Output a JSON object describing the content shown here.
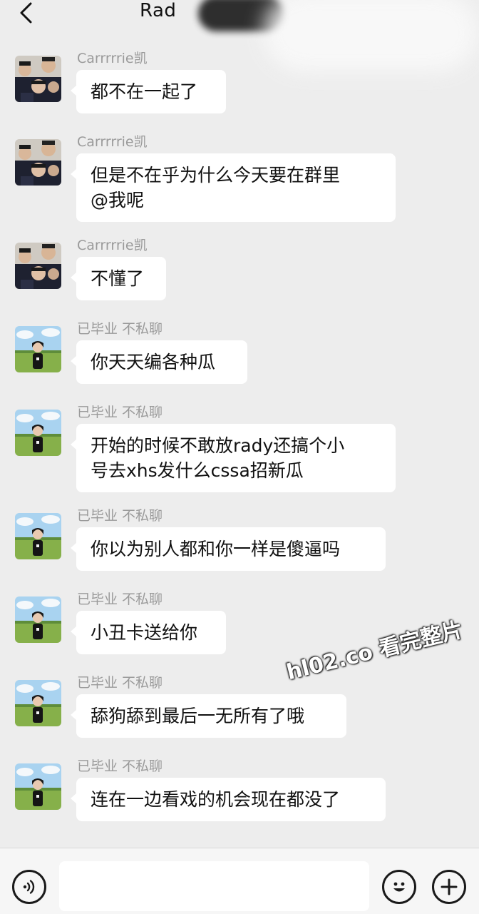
{
  "header": {
    "title": "Rad"
  },
  "messages": [
    {
      "sender": "Carrrrrie凯",
      "avatar": "group-photo-avatar",
      "lines": [
        "都不在一起了"
      ]
    },
    {
      "sender": "Carrrrrie凯",
      "avatar": "group-photo-avatar",
      "lines": [
        "但是不在乎为什么今天要在群里",
        "@我呢"
      ]
    },
    {
      "sender": "Carrrrrie凯",
      "avatar": "group-photo-avatar",
      "lines": [
        "不懂了"
      ]
    },
    {
      "sender": "已毕业 不私聊",
      "avatar": "field-portrait-avatar",
      "lines": [
        "你天天编各种瓜"
      ]
    },
    {
      "sender": "已毕业 不私聊",
      "avatar": "field-portrait-avatar",
      "lines": [
        "开始的时候不敢放rady还搞个小",
        "号去xhs发什么cssa招新瓜"
      ]
    },
    {
      "sender": "已毕业 不私聊",
      "avatar": "field-portrait-avatar",
      "lines": [
        "你以为别人都和你一样是傻逼吗"
      ]
    },
    {
      "sender": "已毕业 不私聊",
      "avatar": "field-portrait-avatar",
      "lines": [
        "小丑卡送给你"
      ]
    },
    {
      "sender": "已毕业 不私聊",
      "avatar": "field-portrait-avatar",
      "lines": [
        "舔狗舔到最后一无所有了哦"
      ]
    },
    {
      "sender": "已毕业 不私聊",
      "avatar": "field-portrait-avatar",
      "lines": [
        "连在一边看戏的机会现在都没了"
      ]
    }
  ],
  "watermark": "hl02.co 看完整片",
  "footer": {
    "voice_icon": "voice-icon",
    "input_value": "",
    "emoji_icon": "emoji-icon",
    "add_icon": "plus-icon"
  },
  "colors": {
    "background": "#ededed",
    "bubble": "#ffffff",
    "sender": "#9a9a9a"
  }
}
